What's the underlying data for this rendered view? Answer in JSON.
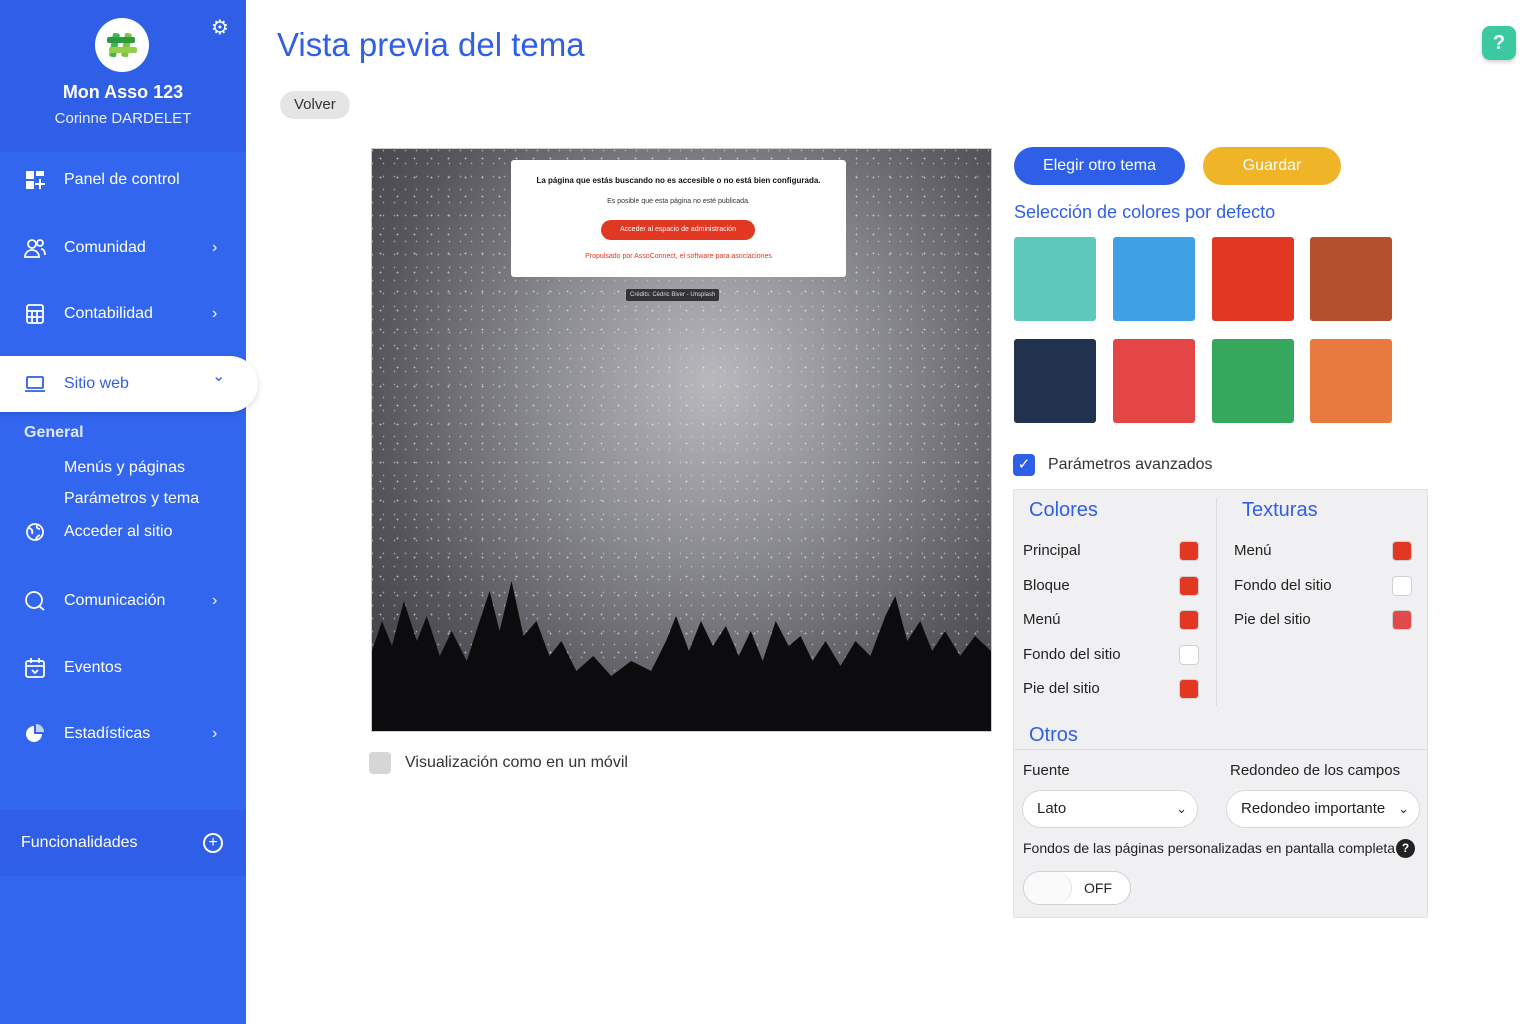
{
  "sidebar": {
    "org_name": "Mon Asso 123",
    "user_name": "Corinne DARDELET",
    "nav": {
      "panel": "Panel de control",
      "comunidad": "Comunidad",
      "contabilidad": "Contabilidad",
      "sitio_web": "Sitio web",
      "comunicacion": "Comunicación",
      "eventos": "Eventos",
      "estadisticas": "Estadísticas"
    },
    "sub_heading": "General",
    "sub_items": {
      "menus": "Menús y páginas",
      "parametros": "Parámetros y tema",
      "acceder": "Acceder al sitio"
    },
    "funcionalidades": "Funcionalidades",
    "chevron_right": "›",
    "chevron_down": "⌄"
  },
  "header": {
    "title": "Vista previa del tema",
    "back": "Volver",
    "help": "?"
  },
  "preview": {
    "message": "La página que estás buscando no es accesible o no está bien configurada.",
    "sub_message": "Es posible que esta página no esté publicada.",
    "admin_button": "Acceder al espacio de administración",
    "powered": "Propulsado por AssoConnect, el software para asociaciones",
    "credit": "Crédits: Cédric Biver - Unsplash",
    "mobile_label": "Visualización como en un móvil"
  },
  "theme": {
    "choose_button": "Elegir otro tema",
    "save_button": "Guardar",
    "default_colors_title": "Selección de colores por defecto",
    "swatches": [
      "#5ec8bd",
      "#3fa0e6",
      "#e23722",
      "#b5502e",
      "#20324e",
      "#e44545",
      "#35a85e",
      "#e8793f"
    ],
    "advanced_label": "Parámetros avanzados"
  },
  "advanced": {
    "colores_title": "Colores",
    "texturas_title": "Texturas",
    "colores": [
      {
        "label": "Principal",
        "color": "#e23722"
      },
      {
        "label": "Bloque",
        "color": "#e23722"
      },
      {
        "label": "Menú",
        "color": "#e23722"
      },
      {
        "label": "Fondo del sitio",
        "color": "#ffffff"
      },
      {
        "label": "Pie del sitio",
        "color": "#e23722"
      }
    ],
    "texturas": [
      {
        "label": "Menú",
        "color": "#e23722"
      },
      {
        "label": "Fondo del sitio",
        "color": "#ffffff"
      },
      {
        "label": "Pie del sitio",
        "color": "#e04a4a"
      }
    ],
    "otros_title": "Otros",
    "fuente_label": "Fuente",
    "fuente_value": "Lato",
    "redondeo_label": "Redondeo de los campos",
    "redondeo_value": "Redondeo importante",
    "fondos_label": "Fondos de las páginas personalizadas en pantalla completa",
    "toggle_value": "OFF"
  }
}
